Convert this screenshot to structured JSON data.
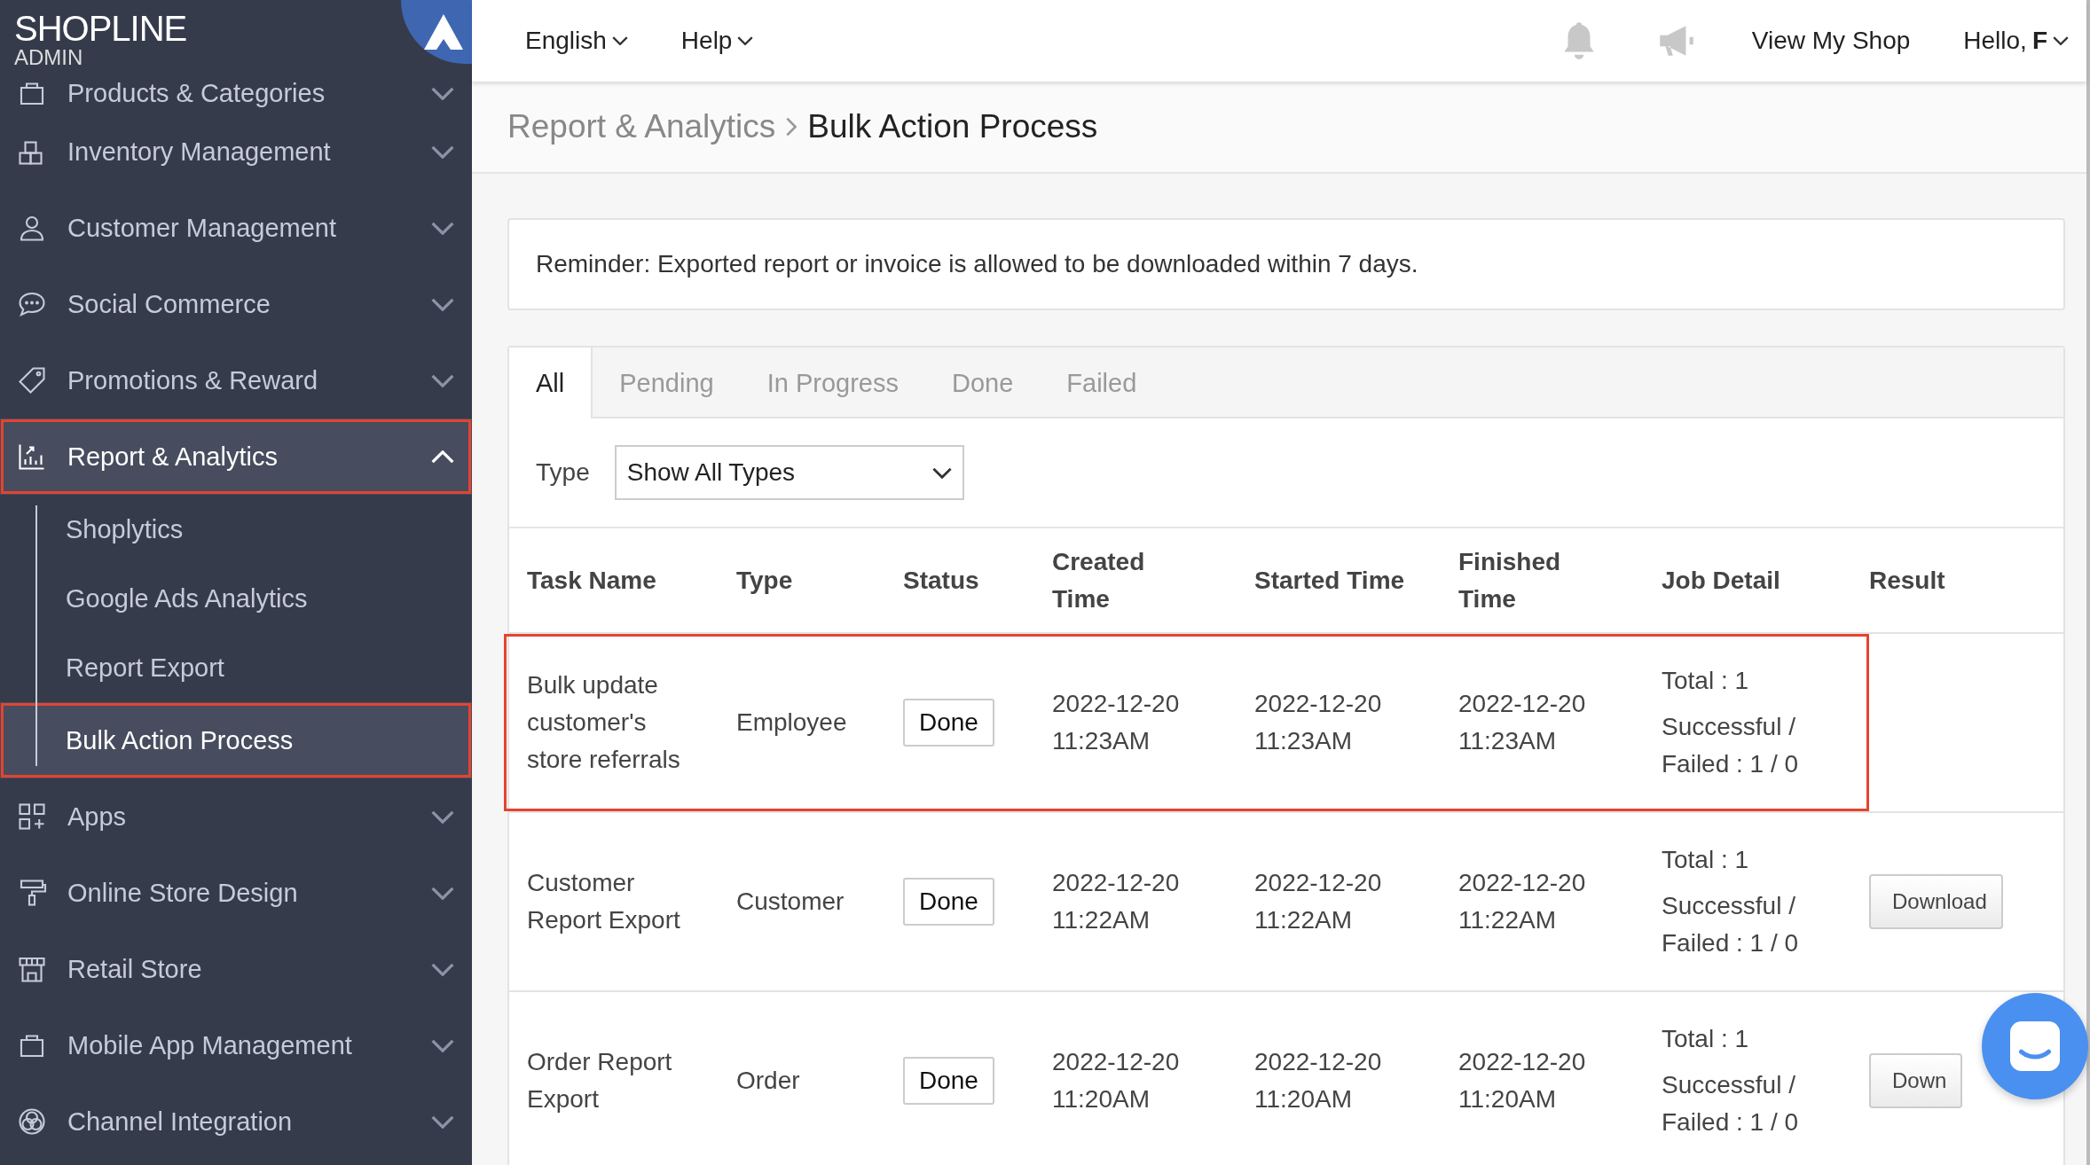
{
  "sidebar": {
    "brand": "**SHOP**LINE",
    "brand_sub": "ADMIN",
    "items": [
      {
        "label": "Products & Categories",
        "expanded": false,
        "selected": false,
        "highlighted": false
      },
      {
        "label": "Inventory Management",
        "expanded": false,
        "selected": false,
        "highlighted": false
      },
      {
        "label": "Customer Management",
        "expanded": false,
        "selected": false,
        "highlighted": false
      },
      {
        "label": "Social Commerce",
        "expanded": false,
        "selected": false,
        "highlighted": false
      },
      {
        "label": "Promotions & Reward",
        "expanded": false,
        "selected": false,
        "highlighted": false
      },
      {
        "label": "Report & Analytics",
        "expanded": true,
        "selected": true,
        "highlighted": true,
        "children": [
          {
            "label": "Shoplytics",
            "selected": false,
            "highlighted": false
          },
          {
            "label": "Google Ads Analytics",
            "selected": false,
            "highlighted": false
          },
          {
            "label": "Report Export",
            "selected": false,
            "highlighted": false
          },
          {
            "label": "Bulk Action Process",
            "selected": true,
            "highlighted": true
          }
        ]
      },
      {
        "label": "Apps",
        "expanded": false,
        "selected": false,
        "highlighted": false
      },
      {
        "label": "Online Store Design",
        "expanded": false,
        "selected": false,
        "highlighted": false
      },
      {
        "label": "Retail Store",
        "expanded": false,
        "selected": false,
        "highlighted": false
      },
      {
        "label": "Mobile App Management",
        "expanded": false,
        "selected": false,
        "highlighted": false
      },
      {
        "label": "Channel Integration",
        "expanded": false,
        "selected": false,
        "highlighted": false
      }
    ]
  },
  "topbar": {
    "menus": [
      "English",
      "Help"
    ],
    "link": "View My Shop",
    "user": "Hello, **F**"
  },
  "breadcrumb": [
    "Report & Analytics",
    "Bulk Action Process"
  ],
  "reminder": "Reminder: Exported report or invoice is allowed to be downloaded within 7 days.",
  "tabs": [
    {
      "label": "All",
      "selected": true
    },
    {
      "label": "Pending",
      "selected": false
    },
    {
      "label": "In Progress",
      "selected": false
    },
    {
      "label": "Done",
      "selected": false
    },
    {
      "label": "Failed",
      "selected": false
    }
  ],
  "filter": {
    "label": "Type",
    "value": "Show All Types"
  },
  "table": {
    "columns": [
      "Task Name",
      "Type",
      "Status",
      "Created Time",
      "Started Time",
      "Finished Time",
      "Job Detail",
      "Result"
    ],
    "rows": [
      {
        "task": "Bulk update customer's store referrals",
        "type": "Employee",
        "status": "Done",
        "created": "2022-12-20 11:23AM",
        "started": "2022-12-20 11:23AM",
        "finished": "2022-12-20 11:23AM",
        "total": "Total : 1",
        "outcome": "Successful / Failed : 1 / 0",
        "highlighted": true
      },
      {
        "task": "Customer Report Export",
        "type": "Customer",
        "status": "Done",
        "created": "2022-12-20 11:22AM",
        "started": "2022-12-20 11:22AM",
        "finished": "2022-12-20 11:22AM",
        "total": "Total : 1",
        "outcome": "Successful / Failed : 1 / 0",
        "result": "Download",
        "highlighted": false
      },
      {
        "task": "Order Report Export",
        "type": "Order",
        "status": "Done",
        "created": "2022-12-20 11:20AM",
        "started": "2022-12-20 11:20AM",
        "finished": "2022-12-20 11:20AM",
        "total": "Total : 1",
        "outcome": "Successful / Failed : 1 / 0",
        "result": "Down",
        "highlighted": false
      }
    ]
  }
}
